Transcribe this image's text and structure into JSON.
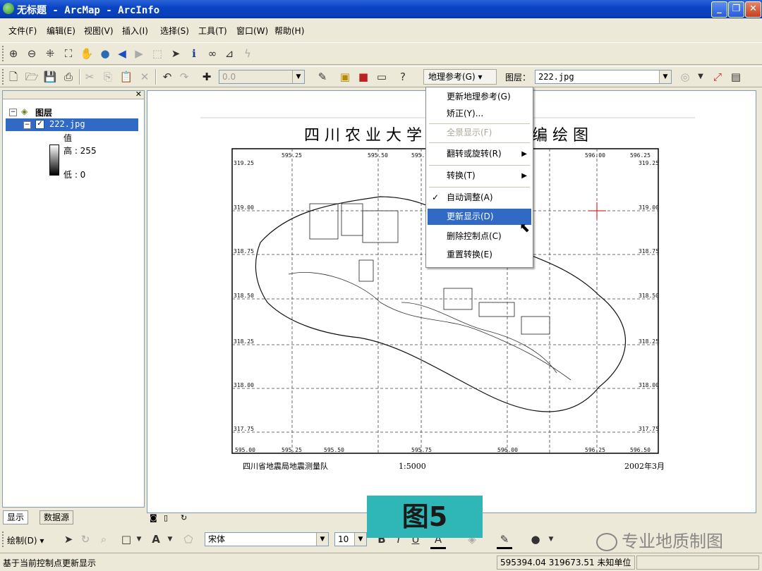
{
  "window": {
    "title": "无标题 - ArcMap - ArcInfo"
  },
  "menu": [
    "文件(F)",
    "编辑(E)",
    "视图(V)",
    "插入(I)",
    "选择(S)",
    "工具(T)",
    "窗口(W)",
    "帮助(H)"
  ],
  "toolbar": {
    "scale_value": "0.0",
    "georef_button": "地理参考(G) ▾",
    "layer_label": "图层：",
    "layer_value": "222.jpg"
  },
  "toc": {
    "root": "图层",
    "layer": "222.jpg",
    "value_label": "值",
    "high": "高 : 255",
    "low": "低 : 0",
    "tabs": [
      "显示",
      "数据源"
    ]
  },
  "dropdown": {
    "items": [
      {
        "label": "更新地理参考(G)"
      },
      {
        "label": "矫正(Y)..."
      },
      {
        "label": "全景显示(F)"
      },
      {
        "label": "翻转或旋转(R)"
      },
      {
        "label": "转换(T)"
      },
      {
        "label": "自动调整(A)"
      },
      {
        "label": "更新显示(D)"
      },
      {
        "label": "删除控制点(C)"
      },
      {
        "label": "重置转换(E)"
      }
    ]
  },
  "map": {
    "title_left": "四 川 农 业 大 学",
    "title_right": "编 绘 图",
    "footer_left": "四川省地震局地震测量队",
    "footer_scale": "1:5000",
    "footer_date": "2002年3月",
    "x_ticks": [
      "595.25",
      "595.50",
      "595.75",
      "596.00",
      "596.25"
    ],
    "x_ticks_bottom": [
      "595.00",
      "595.25",
      "595.50",
      "595.75",
      "596.00",
      "596.25",
      "596.50"
    ],
    "y_ticks": [
      "319.25",
      "319.00",
      "318.75",
      "318.50",
      "318.25",
      "318.00",
      "317.75"
    ],
    "view_tabs": [
      "◙",
      "▯",
      "↻"
    ]
  },
  "draw_toolbar": {
    "draw_label": "绘制(D) ▾",
    "font": "宋体",
    "size": "10"
  },
  "status": {
    "message": "基于当前控制点更新显示",
    "coords": "595394.04  319673.51 未知单位"
  },
  "overlay": {
    "figure_label": "图5",
    "watermark": "专业地质制图"
  }
}
